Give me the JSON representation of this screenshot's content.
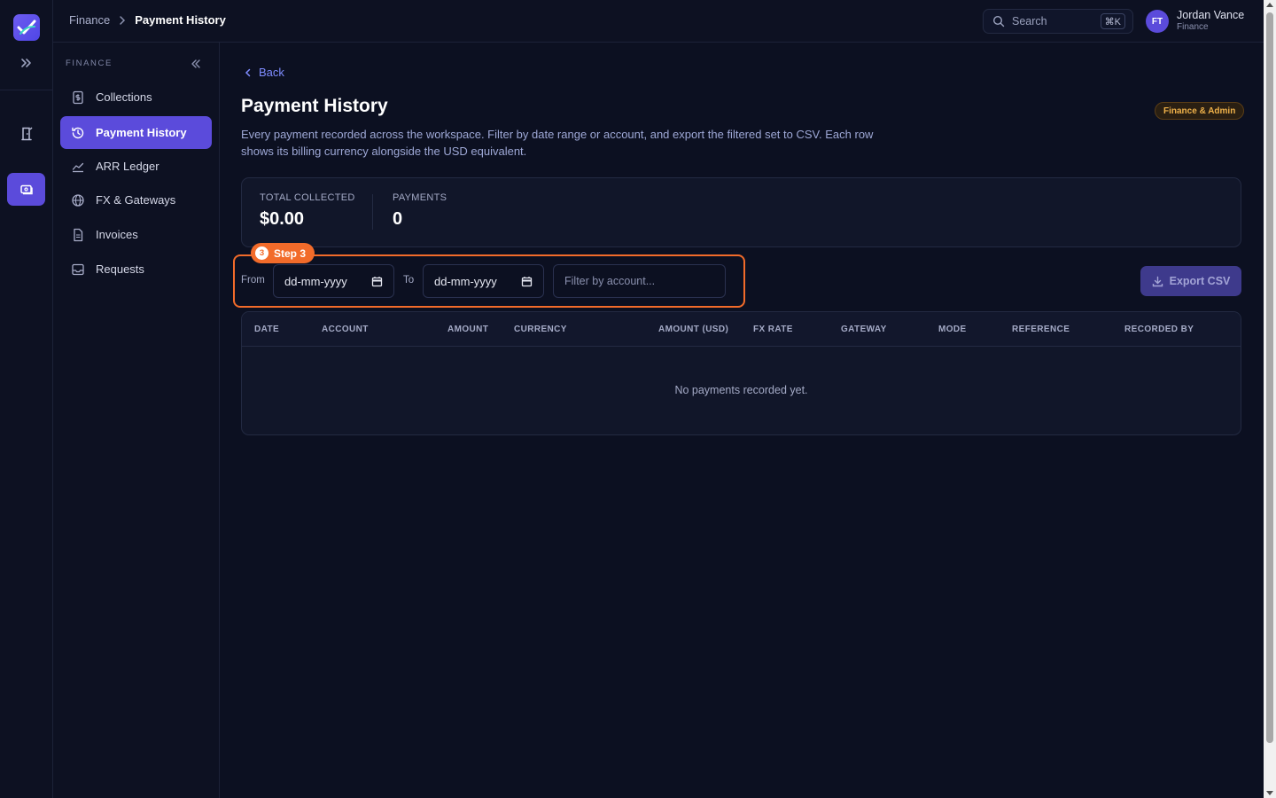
{
  "breadcrumb": {
    "parent": "Finance",
    "current": "Payment History"
  },
  "search": {
    "label": "Search",
    "shortcut": "⌘K"
  },
  "user": {
    "initials": "FT",
    "name": "Jordan Vance",
    "role": "Finance"
  },
  "sidebar": {
    "section_title": "FINANCE",
    "items": [
      {
        "label": "Collections",
        "icon": "dollar-doc-icon"
      },
      {
        "label": "Payment History",
        "icon": "history-icon",
        "active": true
      },
      {
        "label": "ARR Ledger",
        "icon": "chart-line-icon"
      },
      {
        "label": "FX & Gateways",
        "icon": "globe-icon"
      },
      {
        "label": "Invoices",
        "icon": "file-icon"
      },
      {
        "label": "Requests",
        "icon": "inbox-icon"
      }
    ]
  },
  "main": {
    "back_label": "Back",
    "title": "Payment History",
    "role_badge": "Finance & Admin",
    "description": "Every payment recorded across the workspace. Filter by date range or account, and export the filtered set to CSV. Each row shows its billing currency alongside the USD equivalent.",
    "stats": [
      {
        "label": "TOTAL COLLECTED",
        "value": "$0.00"
      },
      {
        "label": "PAYMENTS",
        "value": "0"
      }
    ],
    "step": {
      "number": "3",
      "label": "Step 3"
    },
    "filters": {
      "from_label": "From",
      "from_value": "dd-mm-yyyy",
      "to_label": "To",
      "to_value": "dd-mm-yyyy",
      "account_placeholder": "Filter by account..."
    },
    "export_label": "Export CSV",
    "table": {
      "columns": [
        "DATE",
        "ACCOUNT",
        "AMOUNT",
        "CURRENCY",
        "AMOUNT (USD)",
        "FX RATE",
        "GATEWAY",
        "MODE",
        "REFERENCE",
        "RECORDED BY"
      ],
      "rows": [],
      "empty_message": "No payments recorded yet."
    }
  },
  "colors": {
    "background": "#0c1021",
    "accent": "#5b4bdb",
    "link": "#7f8cff",
    "highlight": "#f26b2a",
    "badge_text": "#f0b24a"
  }
}
